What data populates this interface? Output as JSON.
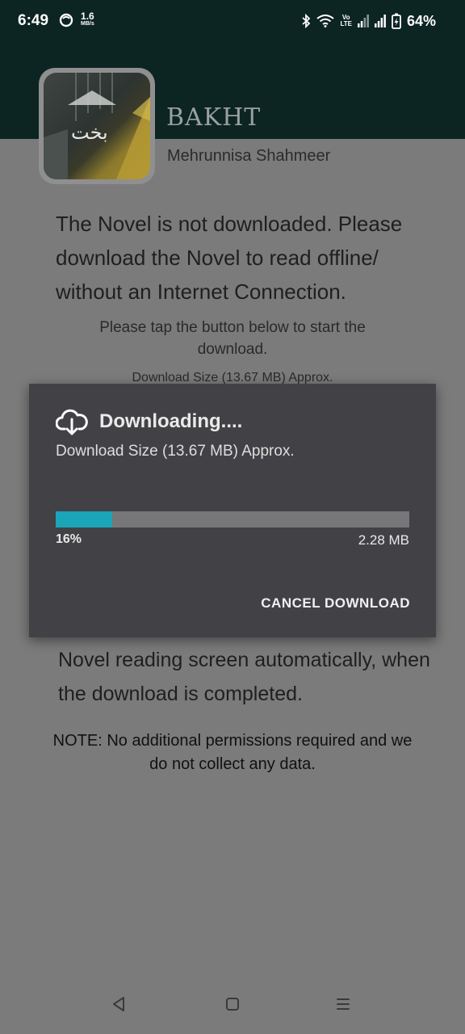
{
  "status_bar": {
    "time": "6:49",
    "net_speed_value": "1.6",
    "net_speed_unit": "MB/s",
    "volte_top": "Vo",
    "volte_bottom": "LTE",
    "battery_percent": "64%"
  },
  "book": {
    "title": "BAKHT",
    "author": "Mehrunnisa Shahmeer",
    "cover_calligraphy": "بخت"
  },
  "body": {
    "not_downloaded_message": "The Novel is not downloaded. Please download the Novel to read offline/ without an Internet Connection.",
    "tap_instruction": "Please tap the button below to start the download.",
    "download_size_text": "Download Size (13.67 MB) Approx.",
    "auto_open_message": "Novel reading screen automatically, when the download is completed.",
    "note": "NOTE: No additional permissions required and we do not collect any data."
  },
  "dialog": {
    "title": "Downloading....",
    "size_text": "Download Size  (13.67 MB) Approx.",
    "progress_percent": 16,
    "progress_label": "16%",
    "downloaded_label": "2.28 MB",
    "cancel_label": "CANCEL DOWNLOAD"
  },
  "icons": {
    "dialog_icon": "cloud-download-icon",
    "nav_back": "back-triangle-icon",
    "nav_home": "home-square-icon",
    "nav_recents": "menu-lines-icon"
  },
  "colors": {
    "header_background": "#0c2422",
    "scrim_background": "#7b7b7b",
    "dialog_background": "#424246",
    "progress_fill": "#1aa5b8",
    "progress_track": "#777779"
  }
}
